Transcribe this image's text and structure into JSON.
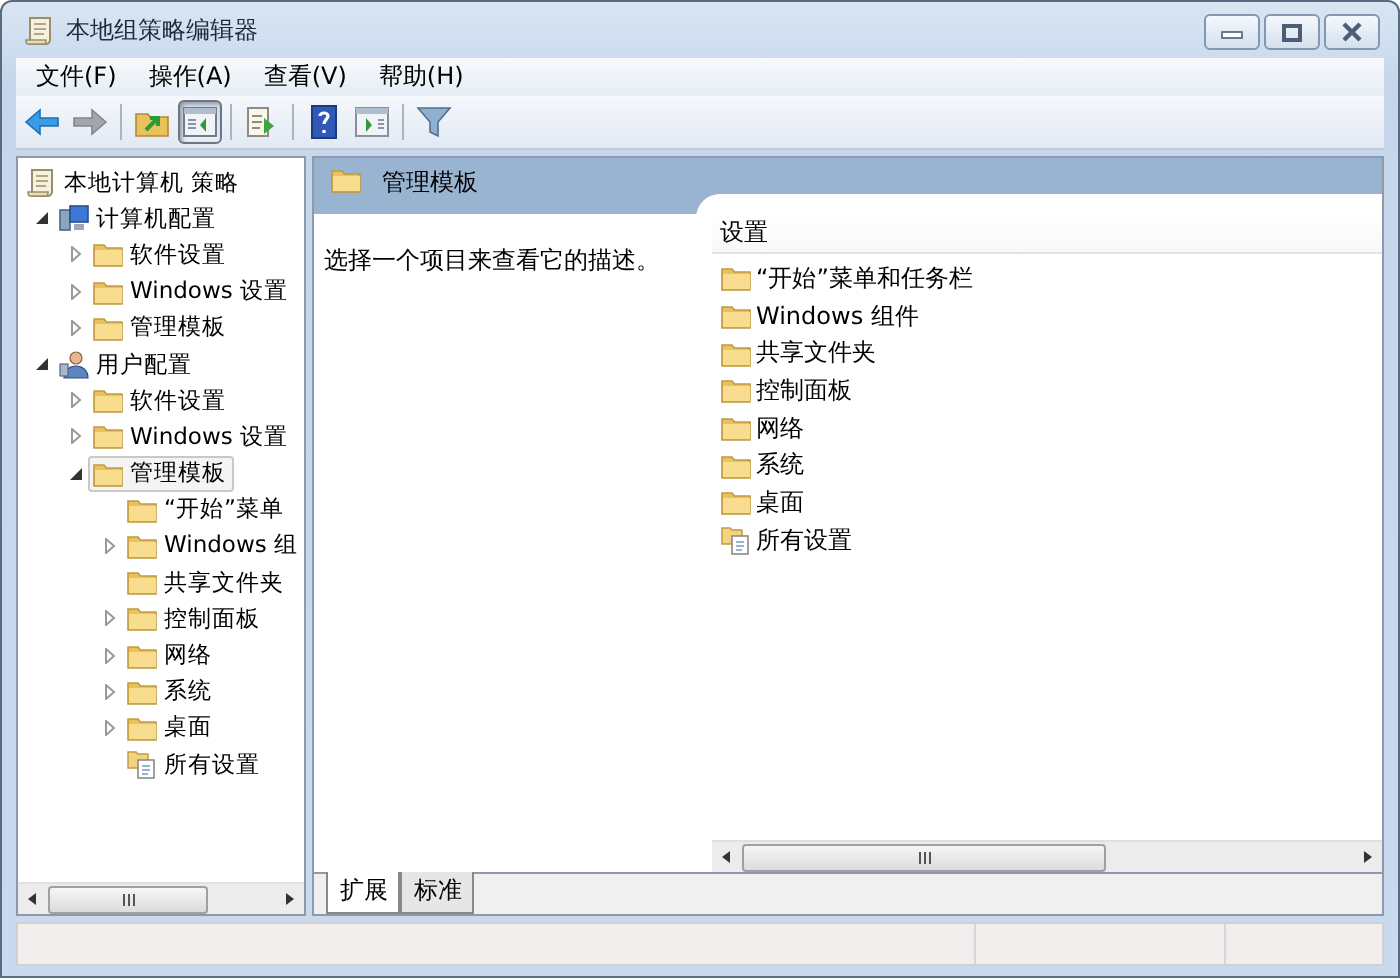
{
  "window": {
    "title": "本地组策略编辑器"
  },
  "title_buttons": [
    {
      "kind": "minimize"
    },
    {
      "kind": "maximize"
    },
    {
      "kind": "close"
    }
  ],
  "menu": [
    "文件(F)",
    "操作(A)",
    "查看(V)",
    "帮助(H)"
  ],
  "toolbar": [
    {
      "kind": "back",
      "pressed": false,
      "disabled": false
    },
    {
      "kind": "forward",
      "pressed": false,
      "disabled": true
    },
    {
      "kind": "separator"
    },
    {
      "kind": "up",
      "pressed": false,
      "disabled": false
    },
    {
      "kind": "tree",
      "pressed": true,
      "disabled": false
    },
    {
      "kind": "separator"
    },
    {
      "kind": "export",
      "pressed": false,
      "disabled": false
    },
    {
      "kind": "separator"
    },
    {
      "kind": "help",
      "pressed": false,
      "disabled": false
    },
    {
      "kind": "pane",
      "pressed": false,
      "disabled": false
    },
    {
      "kind": "separator"
    },
    {
      "kind": "filter",
      "pressed": false,
      "disabled": false
    }
  ],
  "tree": [
    {
      "label": "本地计算机 策略",
      "kind": "policy",
      "selected": false,
      "children": [
        {
          "label": "计算机配置",
          "kind": "computer",
          "expanded": true,
          "selected": false,
          "children": [
            {
              "label": "软件设置",
              "kind": "folder",
              "expanded": false,
              "selected": false
            },
            {
              "label": "Windows 设置",
              "kind": "folder",
              "expanded": false,
              "selected": false
            },
            {
              "label": "管理模板",
              "kind": "folder",
              "expanded": false,
              "selected": false
            }
          ]
        },
        {
          "label": "用户配置",
          "kind": "user",
          "expanded": true,
          "selected": false,
          "children": [
            {
              "label": "软件设置",
              "kind": "folder",
              "expanded": false,
              "selected": false
            },
            {
              "label": "Windows 设置",
              "kind": "folder",
              "expanded": false,
              "selected": false
            },
            {
              "label": "管理模板",
              "kind": "folder",
              "expanded": true,
              "selected": true,
              "children": [
                {
                  "label": "“开始”菜单",
                  "kind": "folder",
                  "selected": false
                },
                {
                  "label": "Windows 组",
                  "kind": "folder",
                  "expanded": false,
                  "selected": false
                },
                {
                  "label": "共享文件夹",
                  "kind": "folder",
                  "selected": false
                },
                {
                  "label": "控制面板",
                  "kind": "folder",
                  "expanded": false,
                  "selected": false
                },
                {
                  "label": "网络",
                  "kind": "folder",
                  "expanded": false,
                  "selected": false
                },
                {
                  "label": "系统",
                  "kind": "folder",
                  "expanded": false,
                  "selected": false
                },
                {
                  "label": "桌面",
                  "kind": "folder",
                  "expanded": false,
                  "selected": false
                },
                {
                  "label": "所有设置",
                  "kind": "all",
                  "selected": false
                }
              ]
            }
          ]
        }
      ]
    }
  ],
  "details": {
    "title": "管理模板",
    "description": "选择一个项目来查看它的描述。",
    "column": "设置",
    "items": [
      {
        "label": "“开始”菜单和任务栏",
        "kind": "folder"
      },
      {
        "label": "Windows 组件",
        "kind": "folder"
      },
      {
        "label": "共享文件夹",
        "kind": "folder"
      },
      {
        "label": "控制面板",
        "kind": "folder"
      },
      {
        "label": "网络",
        "kind": "folder"
      },
      {
        "label": "系统",
        "kind": "folder"
      },
      {
        "label": "桌面",
        "kind": "folder"
      },
      {
        "label": "所有设置",
        "kind": "all"
      }
    ]
  },
  "view_tabs": [
    {
      "label": "扩展",
      "selected": true
    },
    {
      "label": "标准",
      "selected": false
    }
  ]
}
